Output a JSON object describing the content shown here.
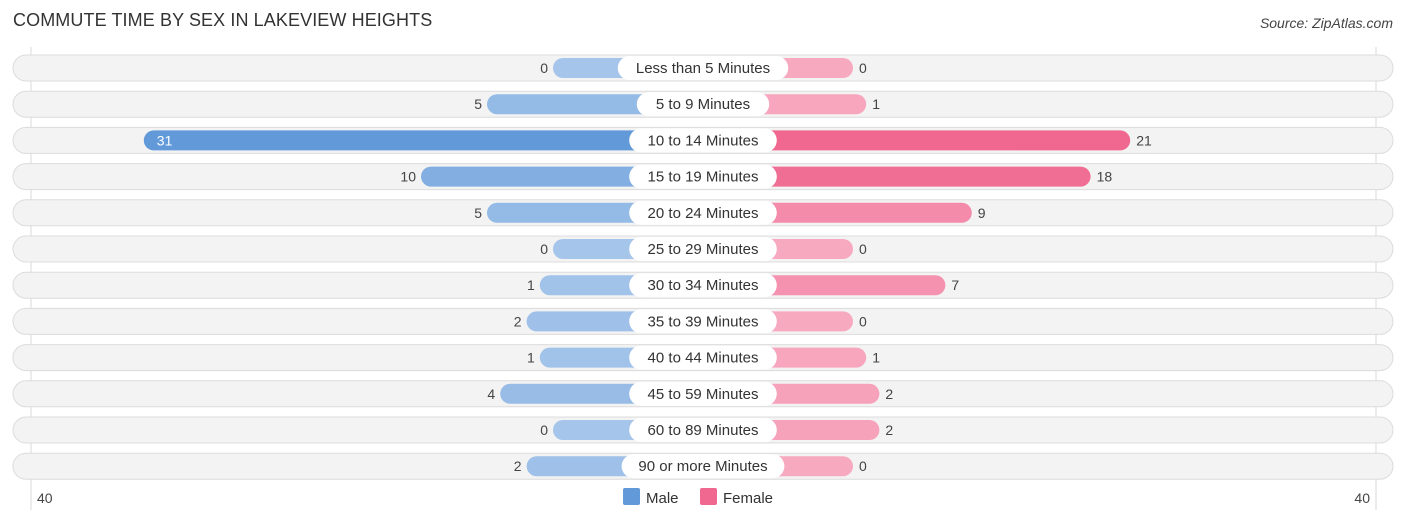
{
  "header": {
    "title": "COMMUTE TIME BY SEX IN LAKEVIEW HEIGHTS",
    "source": "Source: ZipAtlas.com"
  },
  "colors": {
    "male_strong": "#6199d9",
    "male_light": "#a6c5ea",
    "female_strong": "#f06890",
    "female_light": "#f7a9c0",
    "row_bg": "#f3f3f3"
  },
  "chart_data": {
    "type": "bar",
    "orientation": "horizontal-diverging",
    "title": "COMMUTE TIME BY SEX IN LAKEVIEW HEIGHTS",
    "categories": [
      "Less than 5 Minutes",
      "5 to 9 Minutes",
      "10 to 14 Minutes",
      "15 to 19 Minutes",
      "20 to 24 Minutes",
      "25 to 29 Minutes",
      "30 to 34 Minutes",
      "35 to 39 Minutes",
      "40 to 44 Minutes",
      "45 to 59 Minutes",
      "60 to 89 Minutes",
      "90 or more Minutes"
    ],
    "series": [
      {
        "name": "Male",
        "values": [
          0,
          5,
          31,
          10,
          5,
          0,
          1,
          2,
          1,
          4,
          0,
          2
        ]
      },
      {
        "name": "Female",
        "values": [
          0,
          1,
          21,
          18,
          9,
          0,
          7,
          0,
          1,
          2,
          2,
          0
        ]
      }
    ],
    "axis": {
      "left_label": "40",
      "right_label": "40",
      "range": [
        40,
        40
      ]
    },
    "legend": {
      "position": "bottom-center",
      "items": [
        "Male",
        "Female"
      ]
    },
    "grid": false
  }
}
